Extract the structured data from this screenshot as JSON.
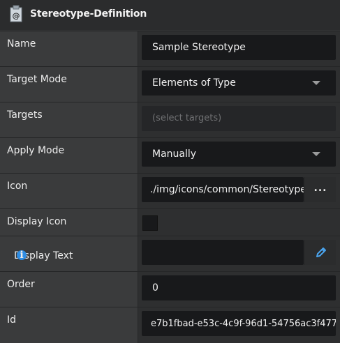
{
  "header": {
    "title": "Stereotype-Definition",
    "icon": "stereotype-icon"
  },
  "rows": {
    "name": {
      "label": "Name",
      "value": "Sample Stereotype"
    },
    "target_mode": {
      "label": "Target Mode",
      "value": "Elements of Type"
    },
    "targets": {
      "label": "Targets",
      "placeholder": "(select targets)"
    },
    "apply_mode": {
      "label": "Apply Mode",
      "value": "Manually"
    },
    "icon": {
      "label": "Icon",
      "value": "./img/icons/common/Stereotype",
      "button": "..."
    },
    "display_icon": {
      "label": "Display Icon",
      "checked": false
    },
    "display_text": {
      "label": "Display Text",
      "info": "i",
      "value": ""
    },
    "order": {
      "label": "Order",
      "value": "0"
    },
    "id": {
      "label": "Id",
      "value": "e7b1fbad-e53c-4c9f-96d1-54756ac3f477"
    }
  },
  "colors": {
    "background": "#333435",
    "field": "#18191b",
    "accent": "#2f8de4"
  }
}
